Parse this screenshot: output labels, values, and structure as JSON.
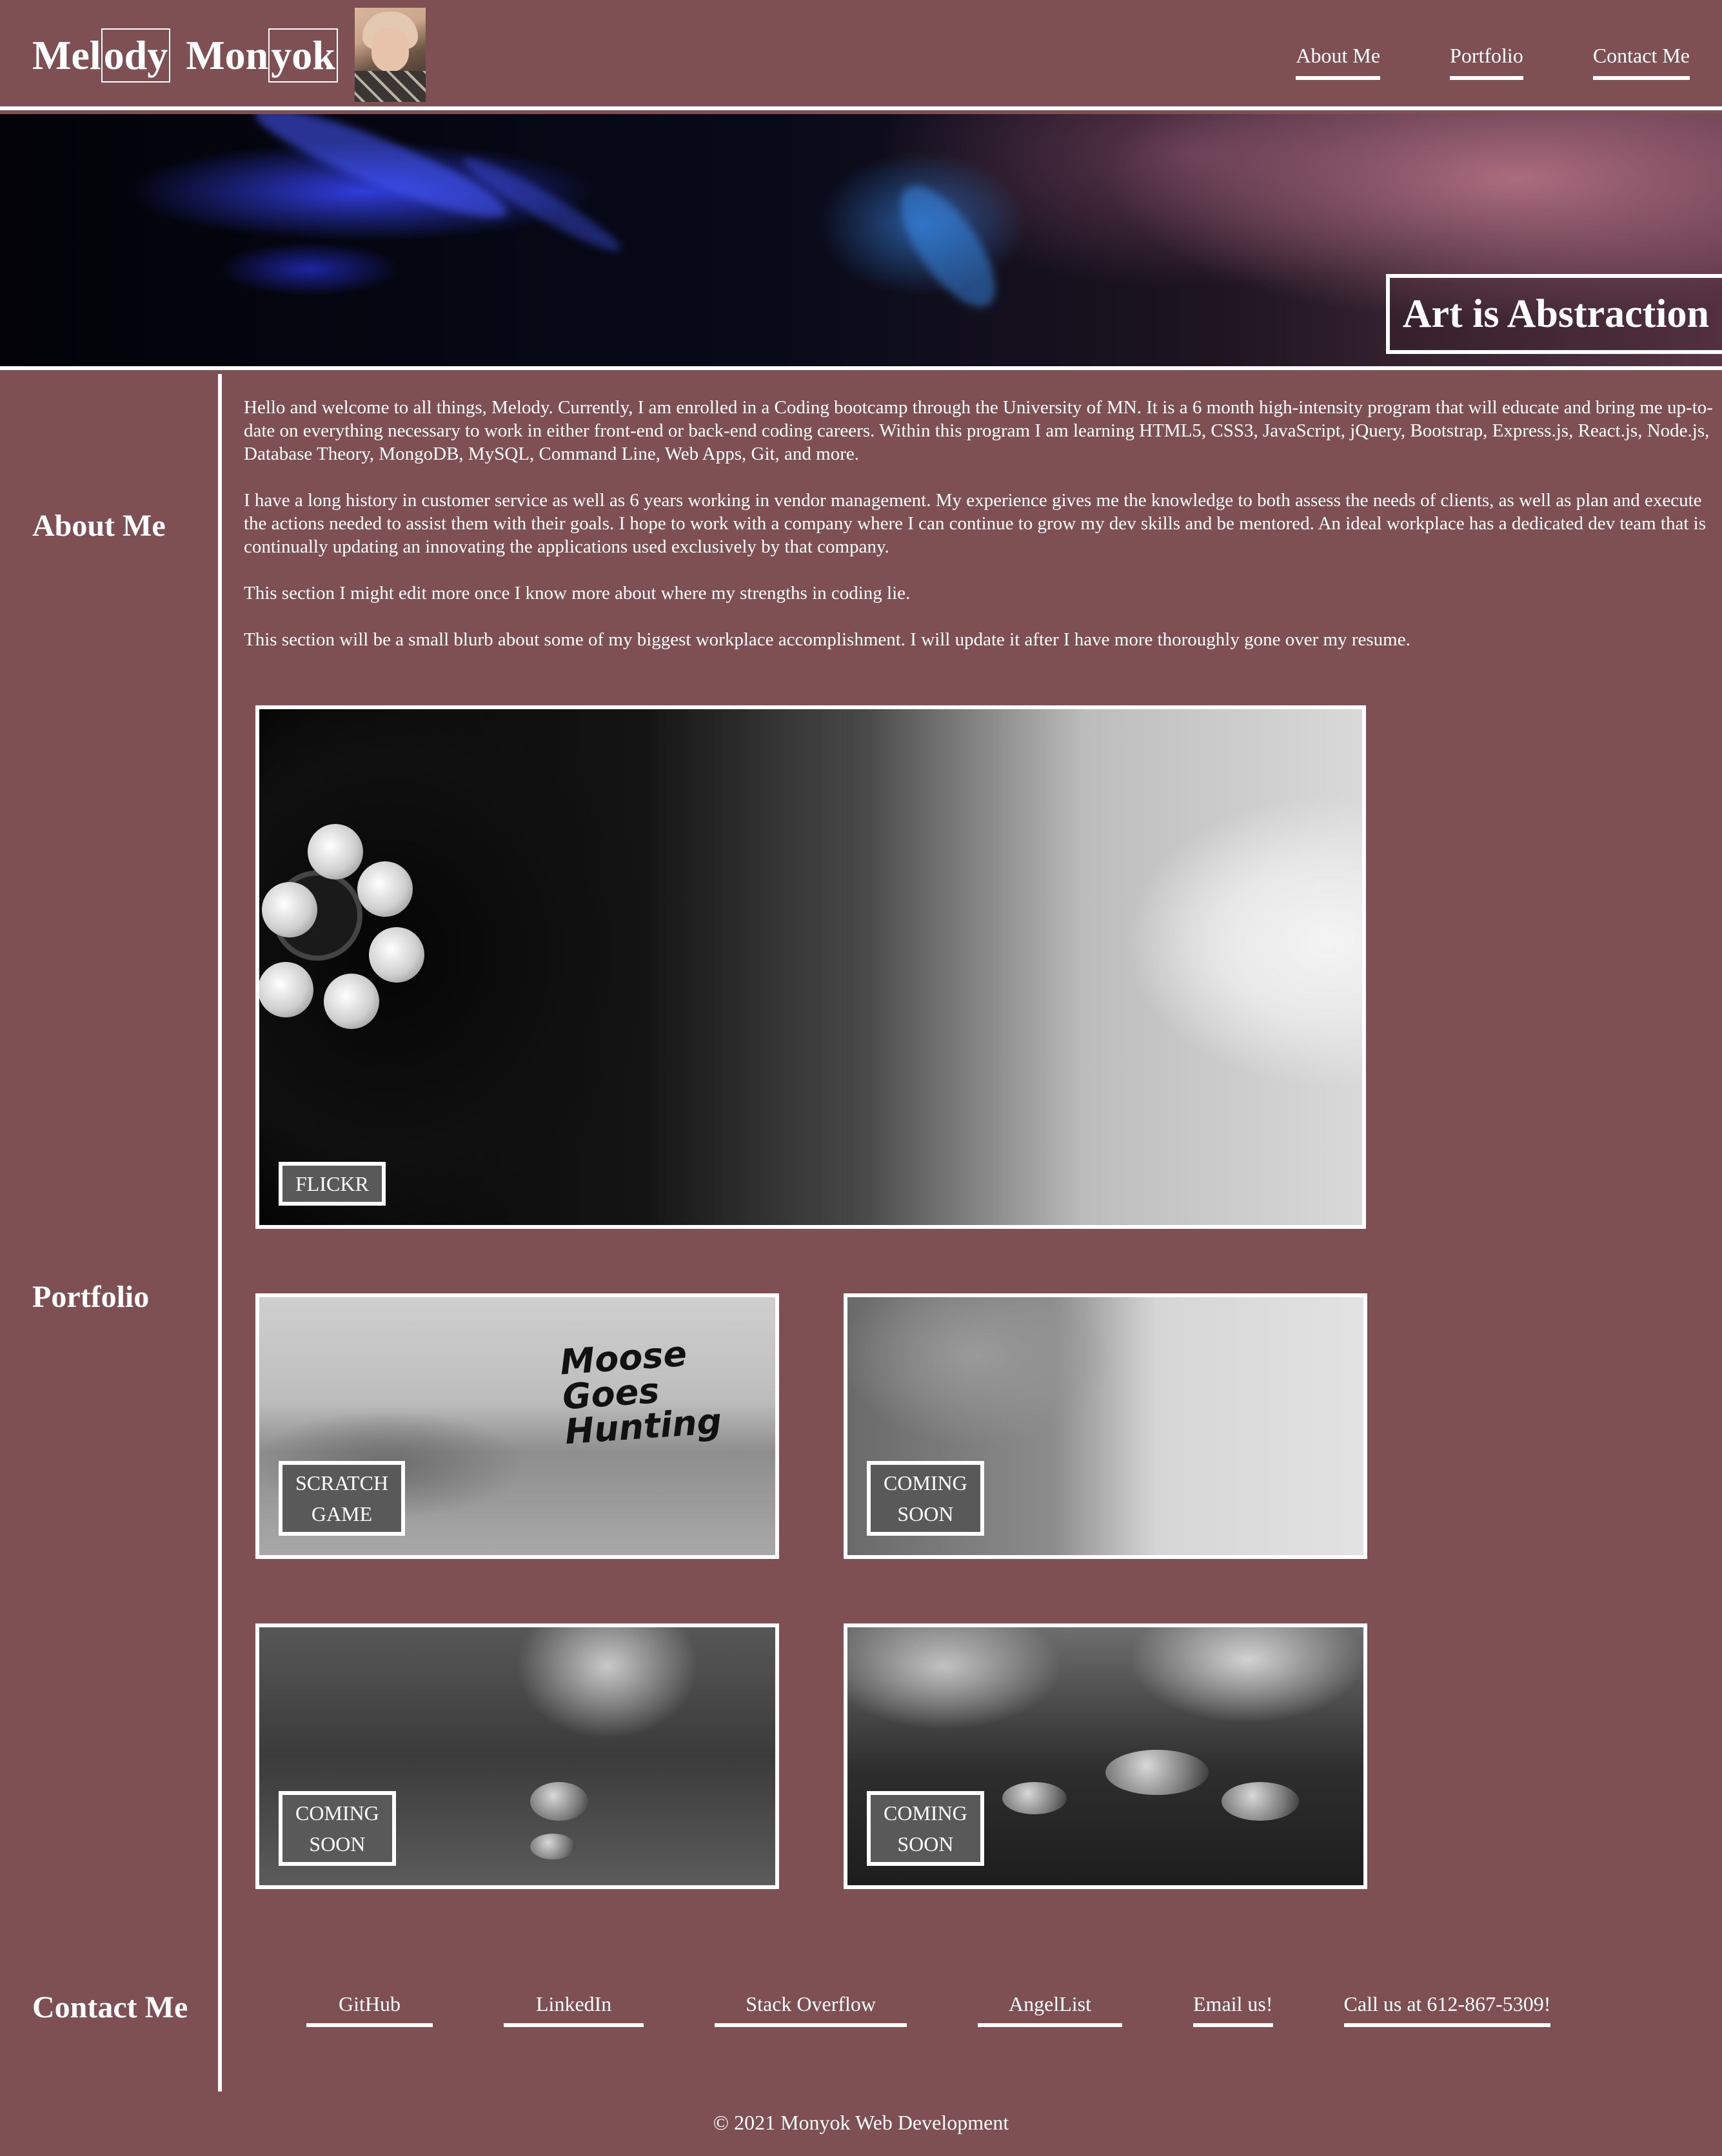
{
  "header": {
    "logo_parts": [
      "Mel",
      "ody",
      "Mon",
      "yok"
    ],
    "nav": [
      "About Me",
      "Portfolio",
      "Contact Me"
    ]
  },
  "hero": {
    "title": "Art is Abstraction"
  },
  "sections": {
    "about": "About Me",
    "portfolio": "Portfolio",
    "contact": "Contact Me"
  },
  "about": {
    "paragraphs": [
      "Hello and welcome to all things, Melody. Currently, I am enrolled in a Coding bootcamp through the University of MN. It is a 6 month high-intensity program that will educate and bring me up-to-date on everything necessary to work in either front-end or back-end coding careers. Within this program I am learning HTML5, CSS3, JavaScript, jQuery, Bootstrap, Express.js, React.js, Node.js, Database Theory, MongoDB, MySQL, Command Line, Web Apps, Git, and more.",
      "I have a long history in customer service as well as 6 years working in vendor management. My experience gives me the knowledge to both assess the needs of clients, as well as plan and execute the actions needed to assist them with their goals. I hope to work with a company where I can continue to grow my dev skills and be mentored. An ideal workplace has a dedicated dev team that is continually updating an innovating the applications used exclusively by that company.",
      "This section I might edit more once I know more about where my strengths in coding lie.",
      "This section will be a small blurb about some of my biggest workplace accomplishment. I will update it after I have more thoroughly gone over my resume."
    ]
  },
  "portfolio": {
    "cards": [
      {
        "label_lines": [
          "FLICKR"
        ]
      },
      {
        "label_lines": [
          "SCRATCH",
          "GAME"
        ],
        "image_text": [
          "Moose",
          "Goes",
          "Hunting"
        ]
      },
      {
        "label_lines": [
          "COMING",
          "SOON"
        ]
      },
      {
        "label_lines": [
          "COMING",
          "SOON"
        ]
      },
      {
        "label_lines": [
          "COMING",
          "SOON"
        ]
      }
    ]
  },
  "contact": {
    "links": [
      "GitHub",
      "LinkedIn",
      "Stack Overflow",
      "AngelList",
      "Email us!",
      "Call us at 612-867-5309!"
    ]
  },
  "footer": {
    "text": "© 2021 Monyok Web Development"
  }
}
